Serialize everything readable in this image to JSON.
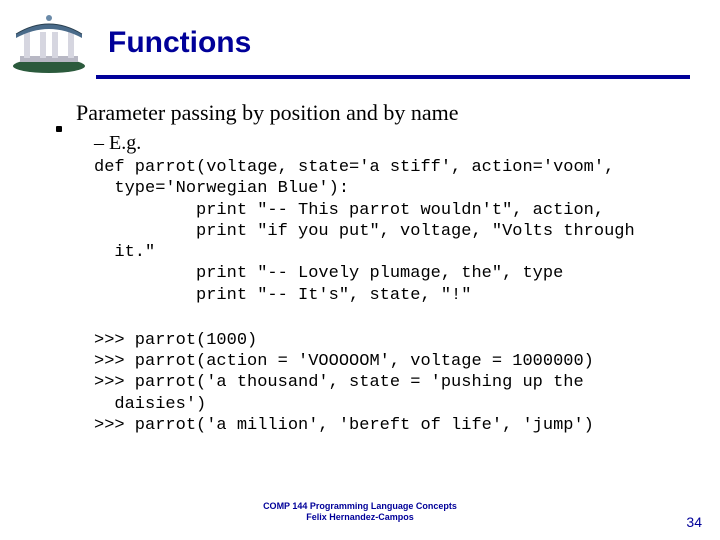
{
  "title": "Functions",
  "bullet": "Parameter passing by position and by name",
  "subbullet": "– E.g.",
  "code1": "def parrot(voltage, state='a stiff', action='voom',\n  type='Norwegian Blue'):\n          print \"-- This parrot wouldn't\", action,\n          print \"if you put\", voltage, \"Volts through\n  it.\"\n          print \"-- Lovely plumage, the\", type\n          print \"-- It's\", state, \"!\"",
  "code2": ">>> parrot(1000)\n>>> parrot(action = 'VOOOOOM', voltage = 1000000)\n>>> parrot('a thousand', state = 'pushing up the\n  daisies')\n>>> parrot('a million', 'bereft of life', 'jump')",
  "footer_line1": "COMP 144 Programming Language Concepts",
  "footer_line2": "Felix Hernandez-Campos",
  "page_number": "34"
}
